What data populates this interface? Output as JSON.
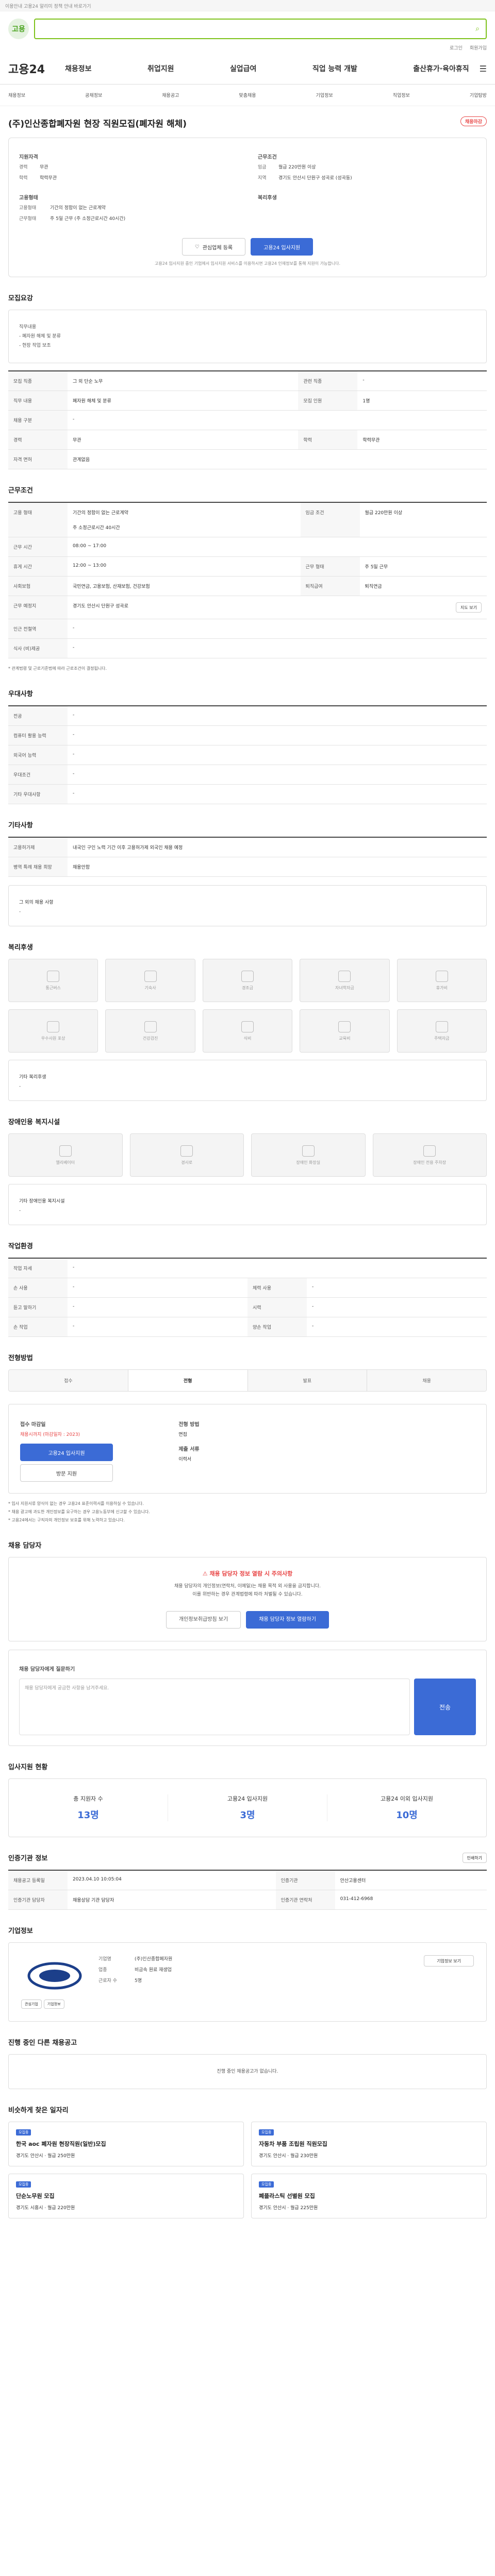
{
  "topbar": {
    "notice": "이용안내 고용24 알리미 정책 안내 바로가기"
  },
  "header": {
    "logo": "고용",
    "search_placeholder": "",
    "user_links": [
      "로그인",
      "회원가입"
    ]
  },
  "gnb": {
    "brand": "고용24",
    "menu": [
      "채용정보",
      "취업지원",
      "실업급여",
      "직업 능력 개발",
      "출산휴가·육아휴직"
    ]
  },
  "subnav": [
    "채용정보",
    "공채정보",
    "채용공고",
    "맞춤채용",
    "기업정보",
    "직업정보",
    "기업탐방"
  ],
  "job": {
    "title": "(주)인산종합폐자원 현장 직원모집(폐자원 해체)",
    "badge": "채용마감",
    "company_label": "지원자격",
    "company_kvs": [
      [
        "경력",
        "무관"
      ],
      [
        "학력",
        "학력무관"
      ]
    ],
    "conditions_label": "근무조건",
    "conditions_kvs": [
      [
        "임금",
        "월급 220만원 이상"
      ],
      [
        "지역",
        "경기도 안산시 단원구 성곡로 (성곡동)"
      ]
    ],
    "employ_label": "고용형태",
    "employ_kvs": [
      [
        "고용형태",
        "기간의 정함이 없는 근로계약"
      ],
      [
        "근무형태",
        "주 5일 근무 (주 소정근로시간 40시간)"
      ]
    ],
    "benefit_label": "복리후생",
    "scrap_button": "관심업체 등록",
    "apply_button": "고용24 입사지원",
    "apply_note": "고용24 입사지원 중인 기업에서 입사지원 서비스를 이용하시면 고용24 인재정보를 통해 지원이 가능합니다."
  },
  "recruit": {
    "heading": "모집요강",
    "desc": [
      "직무내용",
      "- 폐자원 해체 및 분류",
      "- 현장 작업 보조"
    ],
    "rows": [
      [
        "모집 직종",
        "그 외 단순 노무",
        "관련 직종",
        "-"
      ],
      [
        "직무 내용",
        "폐자원 해체 및 분류",
        "모집 인원",
        "1명"
      ],
      [
        "채용 구분",
        "-",
        "",
        ""
      ],
      [
        "경력",
        "무관",
        "학력",
        "학력무관"
      ],
      [
        "자격 면허",
        "관계없음",
        "",
        ""
      ]
    ]
  },
  "conditions": {
    "heading": "근무조건",
    "rows": [
      [
        "고용 형태",
        "기간의 정함이 없는 근로계약",
        "임금 조건",
        "월급 220만원 이상"
      ],
      [
        "",
        "주 소정근로시간 40시간",
        "",
        ""
      ],
      [
        "근무 시간",
        "08:00 ~ 17:00",
        "",
        ""
      ],
      [
        "휴게 시간",
        "12:00 ~ 13:00",
        "근무 형태",
        "주 5일 근무"
      ],
      [
        "사회보험",
        "국민연금, 고용보험, 산재보험, 건강보험",
        "퇴직급여",
        "퇴직연금"
      ],
      [
        "근무 예정지",
        "경기도 안산시 단원구 성곡로",
        "",
        ""
      ],
      [
        "인근 전철역",
        "-",
        "",
        ""
      ],
      [
        "식사 (비)제공",
        "-",
        "",
        ""
      ]
    ],
    "map_button": "지도 보기",
    "note": "* 관계법령 및 근로기준법에 따라 근로조건이 결정됩니다."
  },
  "preference": {
    "heading": "우대사항",
    "rows": [
      [
        "전공",
        "-"
      ],
      [
        "컴퓨터 활용 능력",
        "-"
      ],
      [
        "외국어 능력",
        "-"
      ],
      [
        "우대조건",
        "-"
      ],
      [
        "기타 우대사항",
        "-"
      ]
    ]
  },
  "others": {
    "heading": "기타사항",
    "rows": [
      [
        "고용허가제",
        "내국인 구인 노력 기간 이후 고용허가제 외국인 채용 예정"
      ],
      [
        "병역 특례 채용 희망",
        "채용안함"
      ]
    ],
    "box_title": "그 외의 채용 사항",
    "box_value": "-"
  },
  "welfare": {
    "heading": "복리후생",
    "items": [
      "통근버스",
      "기숙사",
      "경조금",
      "자녀학자금",
      "휴가비",
      "우수사원 포상",
      "건강검진",
      "식비",
      "교육비",
      "주택자금"
    ],
    "box_title": "기타 복리후생",
    "box_value": "-"
  },
  "disabled": {
    "heading": "장애인용 복지시설",
    "items": [
      "엘리베이터",
      "경사로",
      "장애인 화장실",
      "장애인 전용 주차장"
    ],
    "box_title": "기타 장애인용 복지시설",
    "box_value": "-"
  },
  "env": {
    "heading": "작업환경",
    "rows": [
      [
        "작업 자세",
        "-",
        "",
        ""
      ],
      [
        "손 사용",
        "-",
        "체력 사용",
        "-"
      ],
      [
        "듣고 말하기",
        "-",
        "시력",
        "-"
      ],
      [
        "손 작업",
        "-",
        "양손 작업",
        "-"
      ]
    ]
  },
  "process": {
    "heading": "전형방법",
    "tabs": [
      "접수",
      "전형",
      "발표",
      "채용"
    ],
    "left_title": "접수 마감일",
    "left_value": "채용시까지 (마감일자 : 2023)",
    "apply_btn": "고용24 입사지원",
    "visit_btn": "방문 지원",
    "right_title": "전형 방법",
    "right_value": "면접",
    "docs_title": "제출 서류",
    "docs_value": "이력서",
    "notes": [
      "* 입사 지원서류 양식이 없는 경우 고용24 표준이력서를 이용하실 수 있습니다.",
      "* 채용 광고에 과도한 개인정보를 요구하는 경우 고용노동부에 신고할 수 있습니다.",
      "* 고용24에서는 구직자의 개인정보 보호를 위해 노력하고 있습니다."
    ]
  },
  "contact": {
    "heading": "채용 담당자",
    "alert_title": "채용 담당자 정보 열람 시 주의사항",
    "alert_lines": [
      "채용 담당자의 개인정보(연락처, 이메일)는 채용 목적 외 사용을 금지합니다.",
      "이를 위반하는 경우 관계법령에 따라 처벌될 수 있습니다."
    ],
    "btn1": "개인정보취급방침 보기",
    "btn2": "채용 담당자 정보 열람하기",
    "qna_title": "채용 담당자에게 질문하기",
    "qna_placeholder": "채용 담당자에게 궁금한 사항을 남겨주세요.",
    "qna_button": "전송"
  },
  "stats": {
    "heading": "입사지원 현황",
    "items": [
      [
        "총 지원자 수",
        "13명"
      ],
      [
        "고용24 입사지원",
        "3명"
      ],
      [
        "고용24 이외 입사지원",
        "10명"
      ]
    ]
  },
  "info": {
    "heading": "인증기관 정보",
    "rows": [
      [
        "채용공고 등록일",
        "2023.04.10 10:05:04",
        "인증기관",
        "안산고용센터"
      ],
      [
        "인증기관 담당자",
        "채용상담 기관 담당자",
        "인증기관 연락처",
        "031-412-6968"
      ]
    ],
    "print_btn": "인쇄하기"
  },
  "company": {
    "heading": "기업정보",
    "name_label": "기업명",
    "name": "(주)인산종합폐자원",
    "industry_label": "업종",
    "industry": "비금속 원료 재생업",
    "employees_label": "근로자 수",
    "employees": "5명",
    "btn": "기업정보 보기",
    "logo_sub": [
      "관심기업",
      "기업정보"
    ]
  },
  "similar": {
    "heading": "진행 중인 다른 채용공고",
    "empty": "진행 중인 채용공고가 없습니다.",
    "heading2": "비슷하게 찾은 일자리",
    "cards": [
      [
        "모집중",
        "한국 aoc 폐자원 현장직원(일반)모집",
        "경기도 안산시",
        "월급 250만원"
      ],
      [
        "모집중",
        "자동차 부품 조립원 직원모집",
        "경기도 안산시",
        "월급 230만원"
      ],
      [
        "모집중",
        "단순노무원 모집",
        "경기도 시흥시",
        "월급 220만원"
      ],
      [
        "모집중",
        "폐플라스틱 선별원 모집",
        "경기도 안산시",
        "월급 225만원"
      ]
    ]
  }
}
